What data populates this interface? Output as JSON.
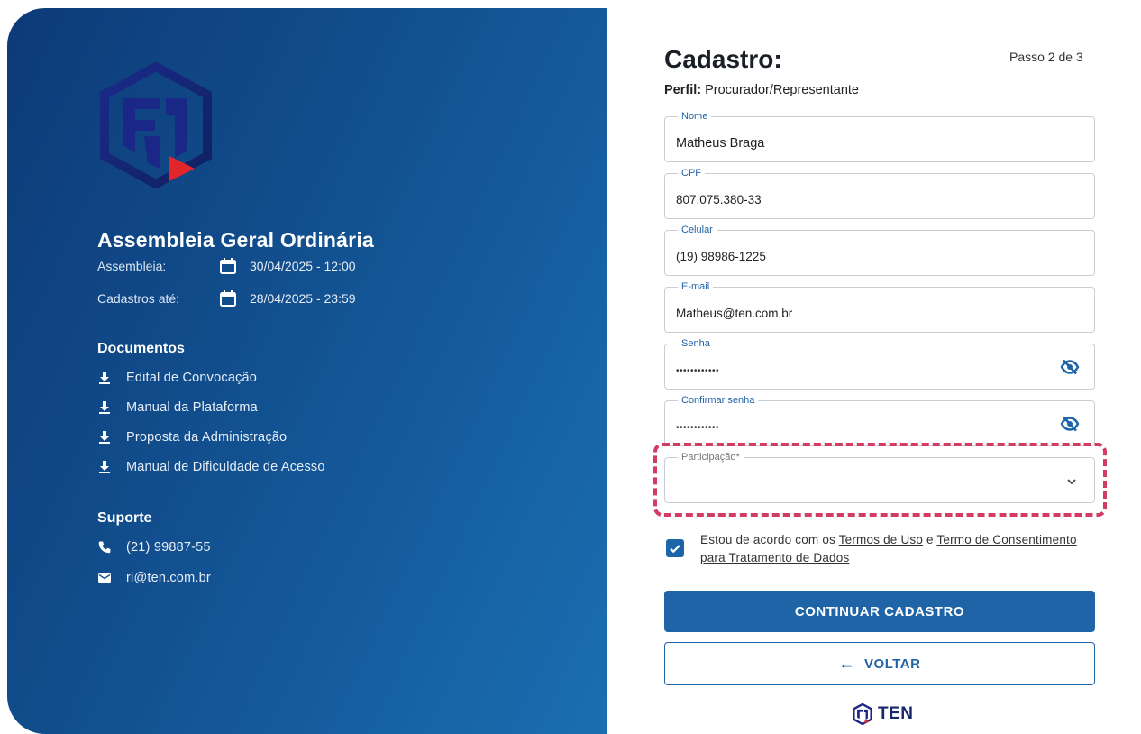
{
  "event": {
    "title": "Assembleia Geral Ordinária",
    "assembleia_label": "Assembleia:",
    "assembleia_value": "30/04/2025 - 12:00",
    "cadastros_label": "Cadastros até:",
    "cadastros_value": "28/04/2025 - 23:59"
  },
  "documents": {
    "title": "Documentos",
    "items": [
      "Edital de Convocação",
      "Manual da Plataforma",
      "Proposta da Administração",
      "Manual de Dificuldade de Acesso"
    ]
  },
  "support": {
    "title": "Suporte",
    "phone": "(21) 99887-55",
    "email": "ri@ten.com.br"
  },
  "form": {
    "title": "Cadastro:",
    "step": "Passo 2 de 3",
    "perfil_label": "Perfil:",
    "perfil_value": " Procurador/Representante",
    "fields": {
      "nome": {
        "label": "Nome",
        "value": "Matheus Braga"
      },
      "cpf": {
        "label": "CPF",
        "value": "807.075.380-33"
      },
      "celular": {
        "label": "Celular",
        "value": "(19) 98986-1225"
      },
      "email": {
        "label": "E-mail",
        "value": "Matheus@ten.com.br"
      },
      "senha": {
        "label": "Senha",
        "value": "••••••••••••"
      },
      "confirmar": {
        "label": "Confirmar senha",
        "value": "••••••••••••"
      },
      "participacao": {
        "label": "Participação*",
        "value": ""
      }
    },
    "terms": {
      "prefix": "Estou de acordo com os ",
      "link1": "Termos de Uso",
      "middle": " e ",
      "link2": "Termo de Consentimento para Tratamento de Dados",
      "checked": true
    },
    "continue_label": "CONTINUAR CADASTRO",
    "back_label": "VOLTAR",
    "brand": "TEN"
  },
  "colors": {
    "primary": "#1f64a7",
    "highlight": "#d33c62",
    "panel_dark": "#0d3a78",
    "panel_light": "#1a6fb2"
  }
}
